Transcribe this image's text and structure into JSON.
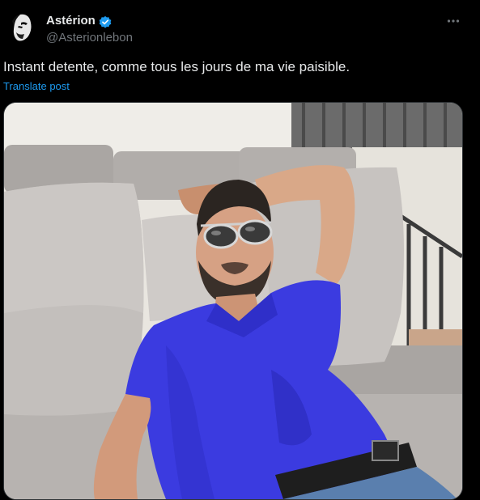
{
  "post": {
    "author_name": "Astérion",
    "author_handle": "@Asterionlebon",
    "text": "Instant detente, comme tous les jours de ma vie paisible.",
    "translate_label": "Translate post",
    "verified": true
  },
  "icons": {
    "verified": "verified-badge-icon",
    "more": "more-options-icon"
  },
  "colors": {
    "background": "#000000",
    "link": "#1d9bf0",
    "verified": "#1d9bf0",
    "secondary_text": "#71767b",
    "shirt": "#3b3be0"
  }
}
